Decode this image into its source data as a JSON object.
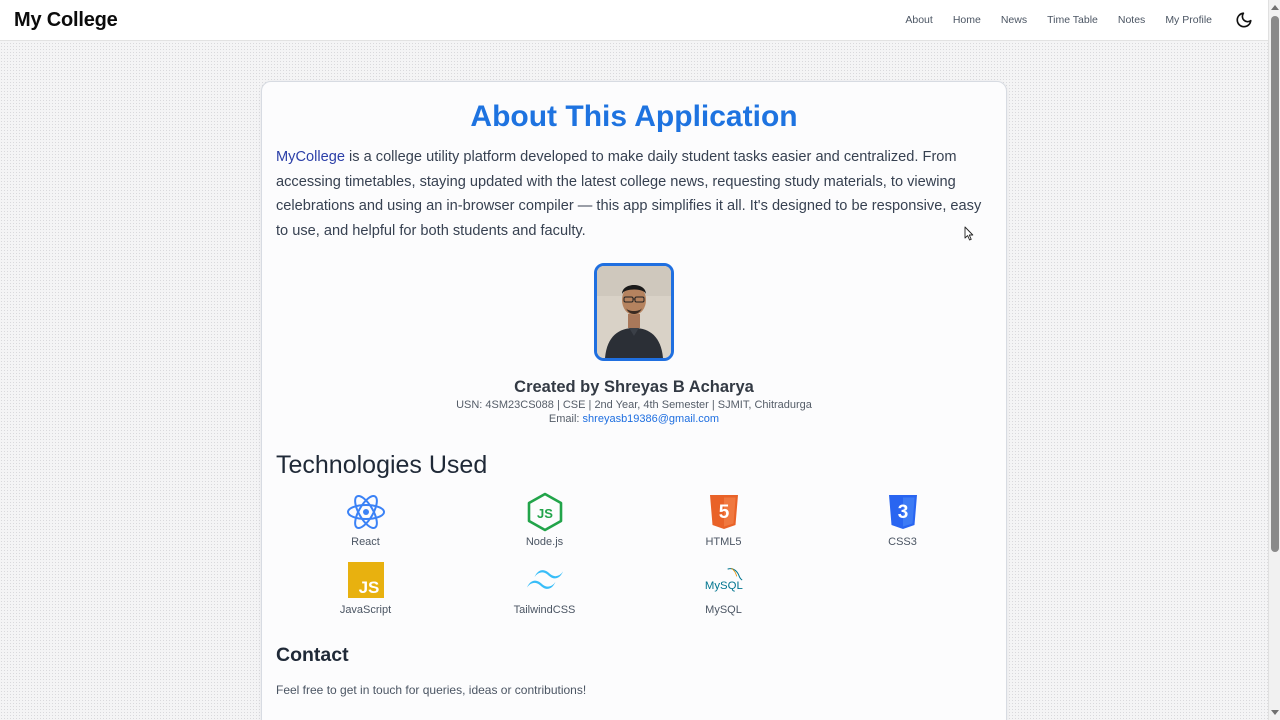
{
  "navbar": {
    "brand": "My College",
    "links": [
      "About",
      "Home",
      "News",
      "Time Table",
      "Notes",
      "My Profile"
    ],
    "theme_icon": "moon-icon"
  },
  "about": {
    "title": "About This Application",
    "brand_name": "MyCollege",
    "intro": " is a college utility platform developed to make daily student tasks easier and centralized. From accessing timetables, staying updated with the latest college news, requesting study materials, to viewing celebrations and using an in-browser compiler — this app simplifies it all. It's designed to be responsive, easy to use, and helpful for both students and faculty.",
    "creator": "Created by Shreyas B Acharya",
    "usn_line": "USN: 4SM23CS088 | CSE | 2nd Year, 4th Semester | SJMIT, Chitradurga",
    "email_label": "Email: ",
    "email": "shreyasb19386@gmail.com",
    "tech_heading": "Technologies Used",
    "technologies": [
      {
        "label": "React",
        "icon": "react-icon"
      },
      {
        "label": "Node.js",
        "icon": "nodejs-icon"
      },
      {
        "label": "HTML5",
        "icon": "html5-icon"
      },
      {
        "label": "CSS3",
        "icon": "css3-icon"
      },
      {
        "label": "JavaScript",
        "icon": "javascript-icon"
      },
      {
        "label": "TailwindCSS",
        "icon": "tailwind-icon"
      },
      {
        "label": "MySQL",
        "icon": "mysql-icon"
      }
    ],
    "contact_heading": "Contact",
    "contact_text": "Feel free to get in touch for queries, ideas or contributions!"
  },
  "colors": {
    "accent": "#1e73e0",
    "brand_name": "#2b3fa8",
    "react": "#3b82f6",
    "node": "#22a44a",
    "html5": "#e96228",
    "css3": "#2965f1",
    "javascript": "#e8b10f",
    "tailwind": "#38bdf8",
    "mysql": "#00758f"
  }
}
